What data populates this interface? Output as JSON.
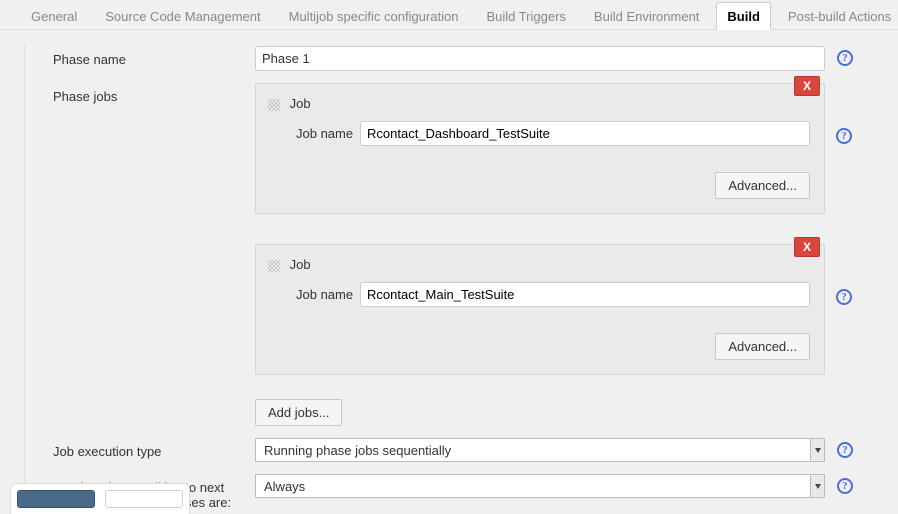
{
  "tabs": {
    "general": "General",
    "scm": "Source Code Management",
    "multijob": "Multijob specific configuration",
    "triggers": "Build Triggers",
    "environment": "Build Environment",
    "build": "Build",
    "post": "Post-build Actions"
  },
  "labels": {
    "phase_name": "Phase name",
    "phase_jobs": "Phase jobs",
    "job_header": "Job",
    "job_name": "Job name",
    "advanced": "Advanced...",
    "add_jobs": "Add jobs...",
    "job_exec_type": "Job execution type",
    "continuation": "Continuation condition to next phase when jobs' statuses are:",
    "delete": "X"
  },
  "values": {
    "phase_name": "Phase 1",
    "jobs": [
      {
        "name": "Rcontact_Dashboard_TestSuite"
      },
      {
        "name": "Rcontact_Main_TestSuite"
      }
    ],
    "job_exec_type": "Running phase jobs sequentially",
    "continuation": "Always"
  },
  "help_glyph": "?"
}
